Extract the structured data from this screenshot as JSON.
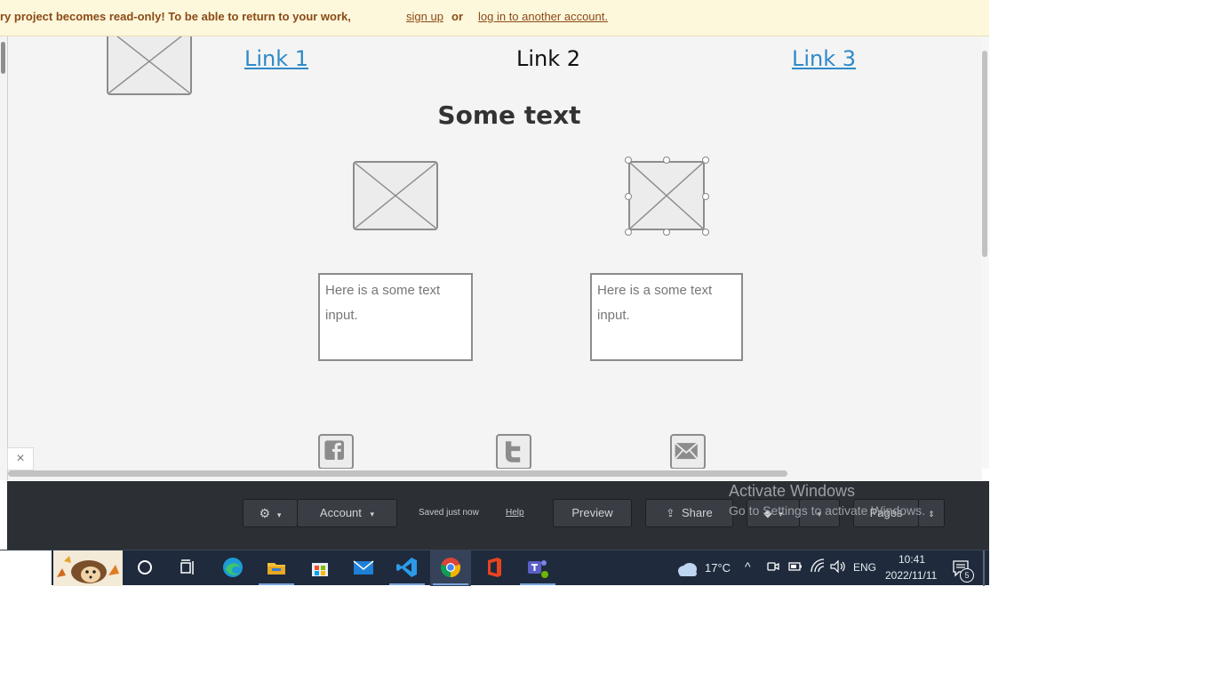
{
  "banner": {
    "message": "ry project becomes read-only! To be able to return to your work,",
    "signup": "sign up",
    "or": "or",
    "login": "log in to another account."
  },
  "canvas": {
    "links": [
      "Link 1",
      "Link 2",
      "Link 3"
    ],
    "heading": "Some text",
    "textbox1": "Here is a some text input.",
    "textbox2": "Here is a some text input."
  },
  "close_icon": "×",
  "toolbar": {
    "settings_caret": "▾",
    "account": "Account",
    "account_caret": "▾",
    "saved": "Saved just now",
    "help": "Help",
    "preview": "Preview",
    "share": "Share",
    "pages": "Pages"
  },
  "watermark": {
    "title": "Activate Windows",
    "subtitle": "Go to Settings to activate Windows."
  },
  "taskbar": {
    "temperature": "17°C",
    "language": "ENG",
    "time": "10:41",
    "date": "2022/11/11",
    "notifications": "5"
  },
  "colors": {
    "banner_bg": "#fdf7dc",
    "banner_text": "#8a4b16",
    "link": "#2f8ac8",
    "toolbar_bg": "#2c3035",
    "taskbar_bg": "#1f2a3c"
  }
}
